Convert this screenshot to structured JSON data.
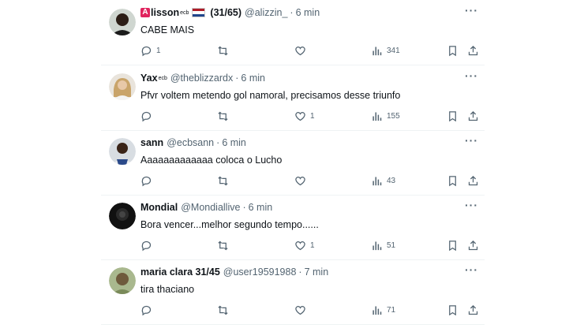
{
  "colors": {
    "flag_red": "#ae1c28",
    "flag_white": "#ffffff",
    "flag_blue": "#21468b",
    "badge": "#e0245e"
  },
  "tweets": [
    {
      "badge": "A",
      "name": "lisson",
      "sup": "ecb",
      "flag_icon": "netherlands-flag-icon",
      "extra": "(31/65)",
      "handle": "@alizzin_",
      "time": "6 min",
      "text": "CABE MAIS",
      "replies": "1",
      "retweets": "",
      "likes": "",
      "views": "341"
    },
    {
      "name": "Yax",
      "sup": "ecb",
      "handle": "@theblizzardx",
      "time": "6 min",
      "text": "Pfvr voltem metendo gol namoral, precisamos desse triunfo",
      "replies": "",
      "retweets": "",
      "likes": "1",
      "views": "155"
    },
    {
      "name": "sann",
      "handle": "@ecbsann",
      "time": "6 min",
      "text": "Aaaaaaaaaaaaa coloca o Lucho",
      "replies": "",
      "retweets": "",
      "likes": "",
      "views": "43"
    },
    {
      "name": "Mondial",
      "handle": "@Mondiallive",
      "time": "6 min",
      "text": "Bora vencer...melhor segundo tempo......",
      "replies": "",
      "retweets": "",
      "likes": "1",
      "views": "51"
    },
    {
      "name": "maria clara 31/45",
      "handle": "@user19591988",
      "time": "7 min",
      "text": "tira thaciano",
      "replies": "",
      "retweets": "",
      "likes": "",
      "views": "71"
    }
  ]
}
